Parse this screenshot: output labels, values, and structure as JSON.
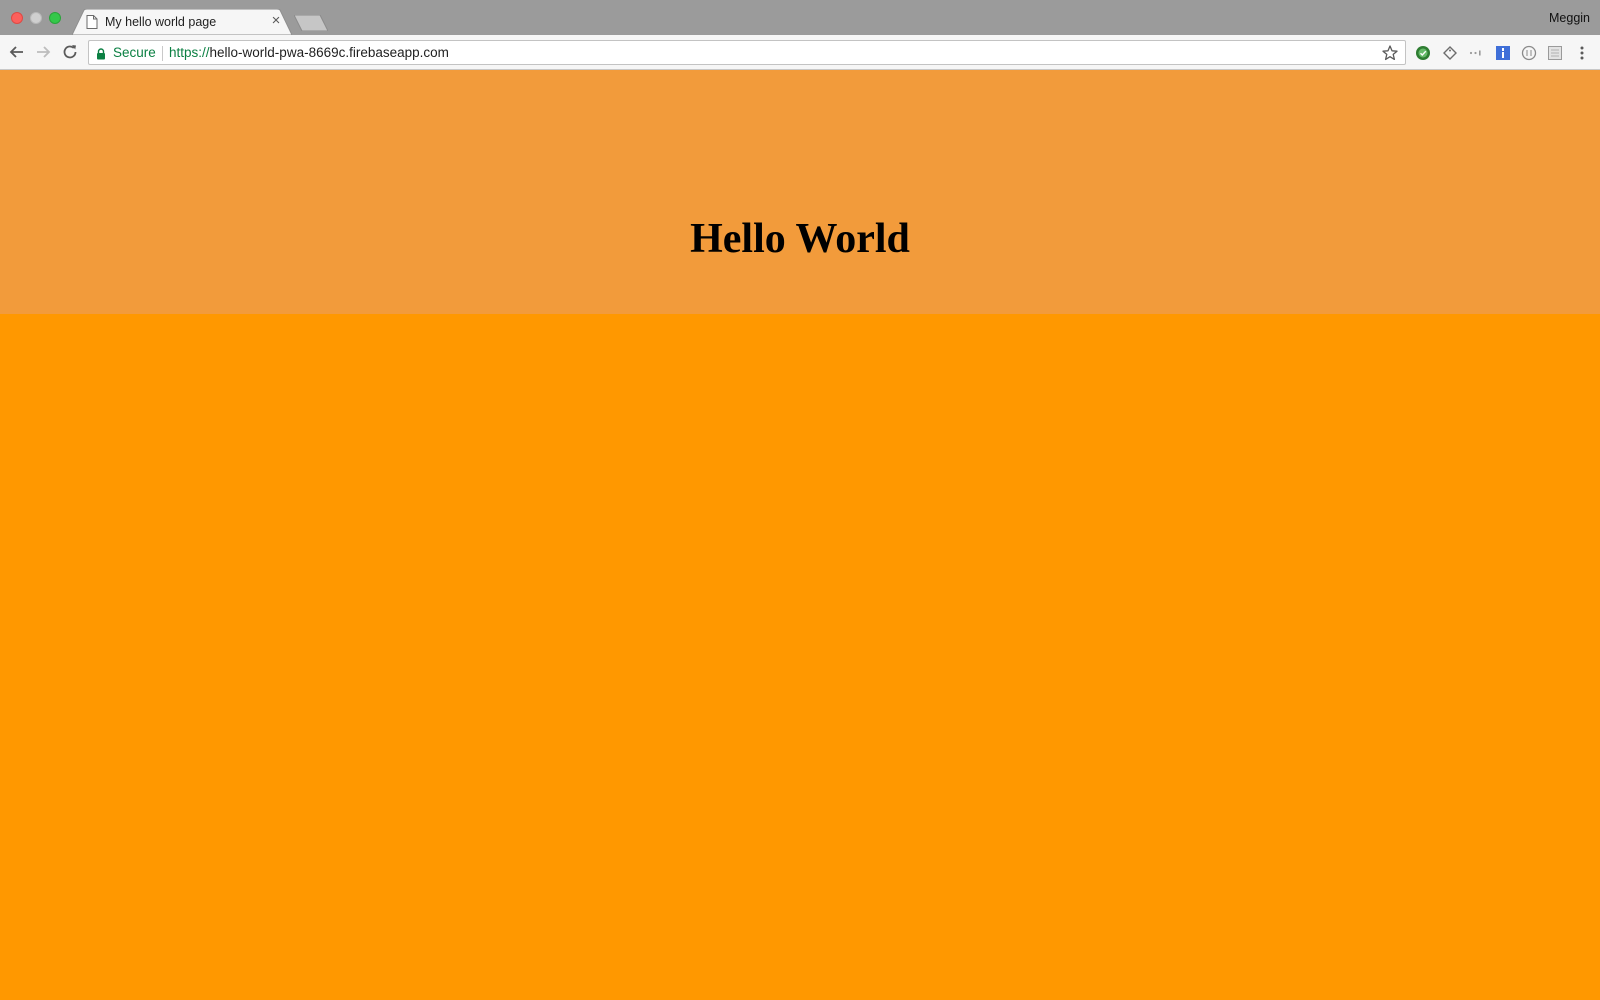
{
  "browser": {
    "tab": {
      "title": "My hello world page",
      "close_glyph": "×",
      "favicon": "document-icon"
    },
    "profile_name": "Meggin",
    "address_bar": {
      "security_label": "Secure",
      "url_scheme": "https://",
      "url_host": "hello-world-pwa-8669c.firebaseapp.com"
    },
    "icons": {
      "back": "arrow-left-icon",
      "forward": "arrow-right-icon",
      "reload": "reload-icon",
      "lock": "lock-icon",
      "star": "star-icon",
      "menu": "kebab-menu-icon"
    },
    "extensions": [
      "green-check-extension-icon",
      "tag-extension-icon",
      "dots-extension-icon",
      "blue-extension-icon",
      "circle-extension-icon",
      "grid-extension-icon"
    ]
  },
  "page": {
    "heading": "Hello World",
    "colors": {
      "header_band": "#f29b3b",
      "body_background": "#ff9800"
    }
  }
}
